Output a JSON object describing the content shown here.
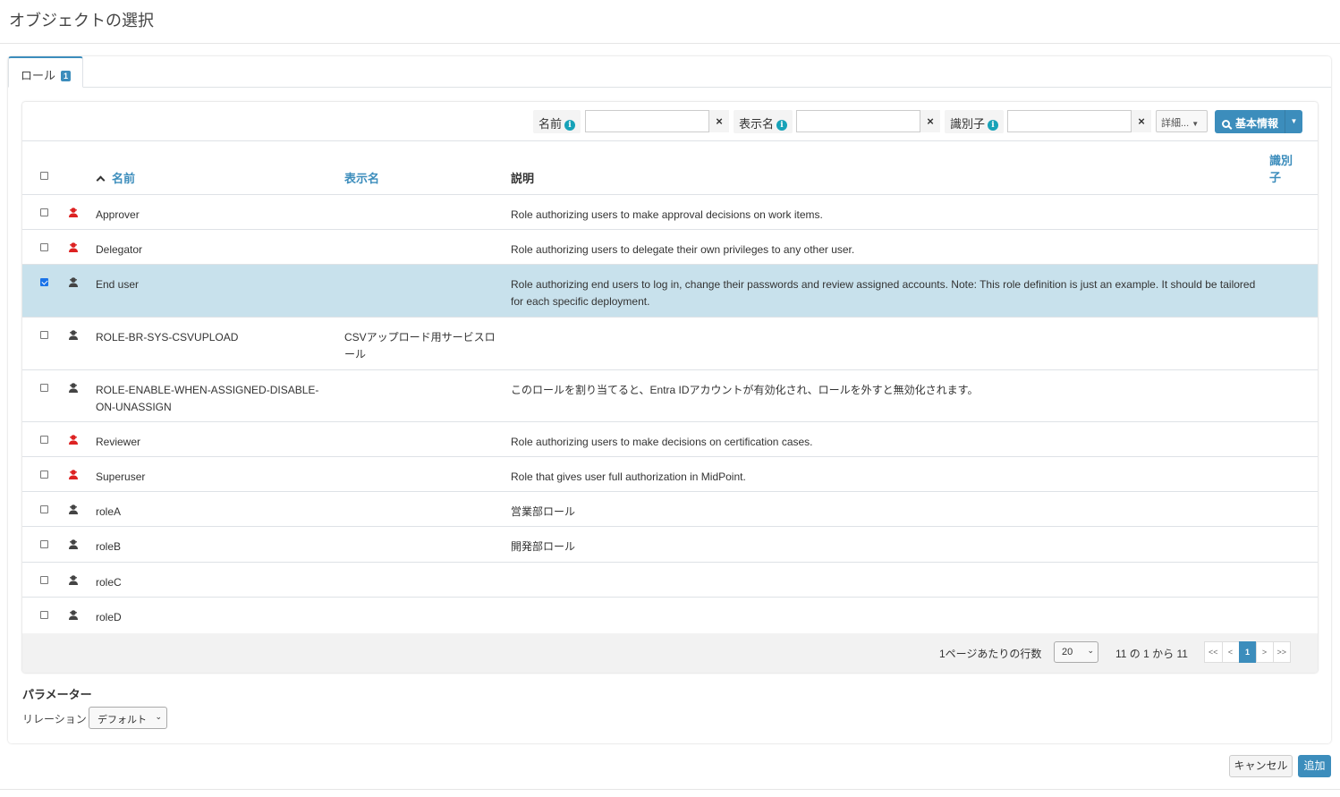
{
  "modal": {
    "title": "オブジェクトの選択"
  },
  "tab": {
    "label": "ロール",
    "badge": "1"
  },
  "search": {
    "name_label": "名前",
    "display_name_label": "表示名",
    "identifier_label": "識別子",
    "clear_symbol": "×",
    "more_label": "詳細...",
    "basic_label": "基本情報"
  },
  "table": {
    "headers": {
      "name": "名前",
      "display_name": "表示名",
      "description": "説明",
      "identifier": "識別子"
    },
    "sort_indicator": "ヘ",
    "rows": [
      {
        "name": "Approver",
        "display_name": "",
        "description": "Role authorizing users to make approval decisions on work items.",
        "icon": "user-red-icon",
        "icon_color": "#dd2222",
        "checked": false
      },
      {
        "name": "Delegator",
        "display_name": "",
        "description": "Role authorizing users to delegate their own privileges to any other user.",
        "icon": "user-red-icon",
        "icon_color": "#dd2222",
        "checked": false
      },
      {
        "name": "End user",
        "display_name": "",
        "description": "Role authorizing end users to log in, change their passwords and review assigned accounts. Note: This role definition is just an example. It should be tailored for each specific deployment.",
        "icon": "user-icon",
        "icon_color": "#444444",
        "checked": true
      },
      {
        "name": "ROLE-BR-SYS-CSVUPLOAD",
        "display_name": "CSVアップロード用サービスロール",
        "description": "",
        "icon": "user-icon",
        "icon_color": "#444444",
        "checked": false
      },
      {
        "name": "ROLE-ENABLE-WHEN-ASSIGNED-DISABLE-ON-UNASSIGN",
        "display_name": "",
        "description": "このロールを割り当てると、Entra IDアカウントが有効化され、ロールを外すと無効化されます。",
        "icon": "user-icon",
        "icon_color": "#444444",
        "checked": false
      },
      {
        "name": "Reviewer",
        "display_name": "",
        "description": "Role authorizing users to make decisions on certification cases.",
        "icon": "user-red-icon",
        "icon_color": "#dd2222",
        "checked": false
      },
      {
        "name": "Superuser",
        "display_name": "",
        "description": "Role that gives user full authorization in MidPoint.",
        "icon": "user-red-icon",
        "icon_color": "#dd2222",
        "checked": false
      },
      {
        "name": "roleA",
        "display_name": "",
        "description": "営業部ロール",
        "icon": "user-icon",
        "icon_color": "#444444",
        "checked": false
      },
      {
        "name": "roleB",
        "display_name": "",
        "description": "開発部ロール",
        "icon": "user-icon",
        "icon_color": "#444444",
        "checked": false
      },
      {
        "name": "roleC",
        "display_name": "",
        "description": "",
        "icon": "user-icon",
        "icon_color": "#444444",
        "checked": false
      },
      {
        "name": "roleD",
        "display_name": "",
        "description": "",
        "icon": "user-icon",
        "icon_color": "#444444",
        "checked": false
      }
    ]
  },
  "pagination": {
    "rows_per_page_label": "1ページあたりの行数",
    "rows_per_page": "20",
    "count_text": "11 の 1 から 11",
    "first": "<<",
    "prev": "<",
    "current": "1",
    "next": ">",
    "last": ">>"
  },
  "parameters": {
    "title": "パラメーター",
    "relation_label": "リレーション",
    "relation_value": "デフォルト"
  },
  "buttons": {
    "cancel": "キャンセル",
    "add": "追加"
  },
  "colors": {
    "accent": "#3c8dbc",
    "selected_row": "#c8e1ec",
    "info": "#17a2b8"
  }
}
